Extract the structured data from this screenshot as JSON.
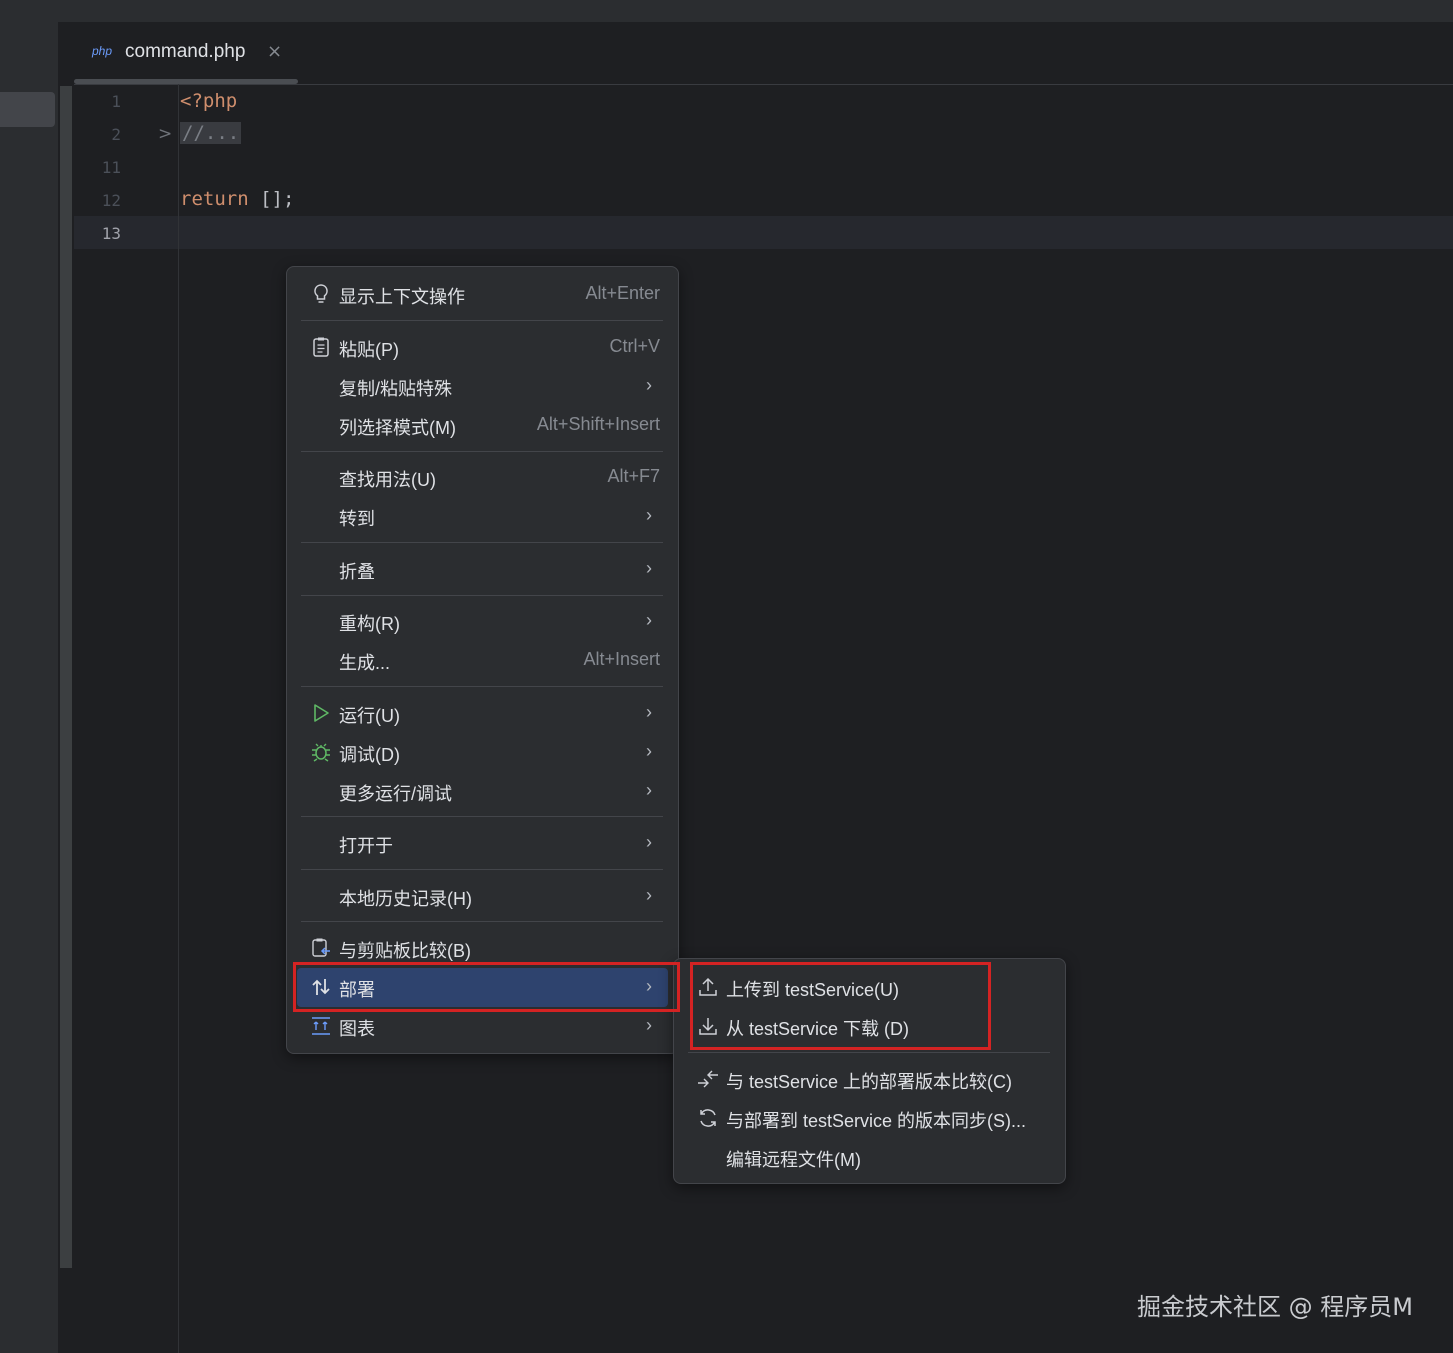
{
  "tab": {
    "lang_badge": "php",
    "file_name": "command.php",
    "close_glyph": "×"
  },
  "editor": {
    "lines": [
      {
        "num": "1",
        "code_kw": "<?php",
        "code_plain": ""
      },
      {
        "num": "2",
        "code_kw": "",
        "code_plain": "//..."
      },
      {
        "num": "11",
        "code_kw": "",
        "code_plain": ""
      },
      {
        "num": "12",
        "code_kw": "return",
        "code_plain": " [];"
      },
      {
        "num": "13",
        "code_kw": "",
        "code_plain": ""
      }
    ],
    "fold_glyph": ">"
  },
  "context_menu": {
    "items": [
      {
        "label": "显示上下文操作",
        "shortcut": "Alt+Enter",
        "icon": "lightbulb-icon"
      },
      {
        "label": "粘贴(P)",
        "shortcut": "Ctrl+V",
        "icon": "clipboard-icon"
      },
      {
        "label": "复制/粘贴特殊",
        "arrow": "›"
      },
      {
        "label": "列选择模式(M)",
        "shortcut": "Alt+Shift+Insert"
      },
      {
        "label": "查找用法(U)",
        "shortcut": "Alt+F7"
      },
      {
        "label": "转到",
        "arrow": "›"
      },
      {
        "label": "折叠",
        "arrow": "›"
      },
      {
        "label": "重构(R)",
        "arrow": "›"
      },
      {
        "label": "生成...",
        "shortcut": "Alt+Insert"
      },
      {
        "label": "运行(U)",
        "arrow": "›",
        "icon": "run-icon"
      },
      {
        "label": "调试(D)",
        "arrow": "›",
        "icon": "debug-icon"
      },
      {
        "label": "更多运行/调试",
        "arrow": "›"
      },
      {
        "label": "打开于",
        "arrow": "›"
      },
      {
        "label": "本地历史记录(H)",
        "arrow": "›"
      },
      {
        "label": "与剪贴板比较(B)",
        "icon": "compare-clipboard-icon"
      },
      {
        "label": "部署",
        "arrow": "›",
        "icon": "deploy-icon",
        "highlighted": true
      },
      {
        "label": "图表",
        "arrow": "›",
        "icon": "diagram-icon"
      }
    ]
  },
  "deploy_submenu": {
    "items": [
      {
        "label": "上传到 testService(U)",
        "icon": "upload-icon"
      },
      {
        "label": "从 testService 下载 (D)",
        "icon": "download-icon"
      },
      {
        "label": "与 testService 上的部署版本比较(C)",
        "icon": "compare-icon"
      },
      {
        "label": "与部署到 testService 的版本同步(S)...",
        "icon": "sync-icon"
      },
      {
        "label": "编辑远程文件(M)"
      }
    ]
  },
  "colors": {
    "highlight": "#2e436e",
    "annotation_red": "#d42323",
    "run_green": "#5fb865",
    "keyword": "#cf8e6d"
  },
  "watermark": "掘金技术社区 @ 程序员M"
}
